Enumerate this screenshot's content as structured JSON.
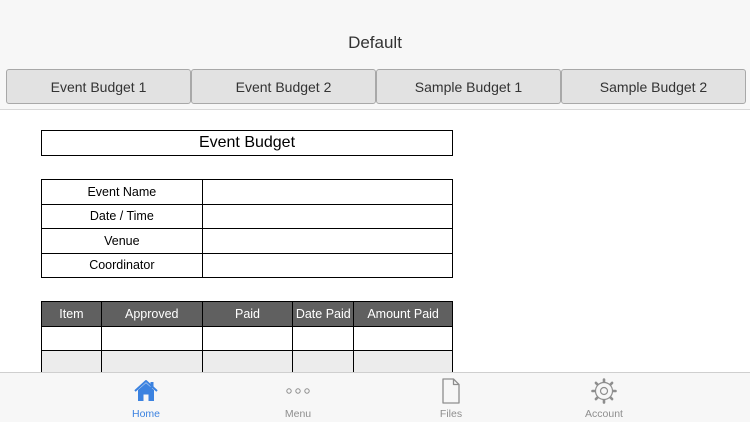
{
  "nav": {
    "title": "Default"
  },
  "tabs": [
    {
      "label": "Event Budget 1"
    },
    {
      "label": "Event Budget 2"
    },
    {
      "label": "Sample Budget 1"
    },
    {
      "label": "Sample Budget 2"
    }
  ],
  "sheet": {
    "title": "Event Budget",
    "info_rows": [
      {
        "label": "Event Name",
        "value": ""
      },
      {
        "label": "Date / Time",
        "value": ""
      },
      {
        "label": "Venue",
        "value": ""
      },
      {
        "label": "Coordinator",
        "value": ""
      }
    ],
    "items_columns": [
      "Item",
      "Approved",
      "Paid",
      "Date Paid",
      "Amount Paid"
    ]
  },
  "tabbar": [
    {
      "label": "Home",
      "icon": "home-icon",
      "active": true
    },
    {
      "label": "Menu",
      "icon": "more-icon",
      "active": false
    },
    {
      "label": "Files",
      "icon": "file-icon",
      "active": false
    },
    {
      "label": "Account",
      "icon": "gear-icon",
      "active": false
    }
  ],
  "colors": {
    "accent": "#3b82e0",
    "header_fill": "#606060",
    "tab_fill": "#e2e2e2"
  }
}
